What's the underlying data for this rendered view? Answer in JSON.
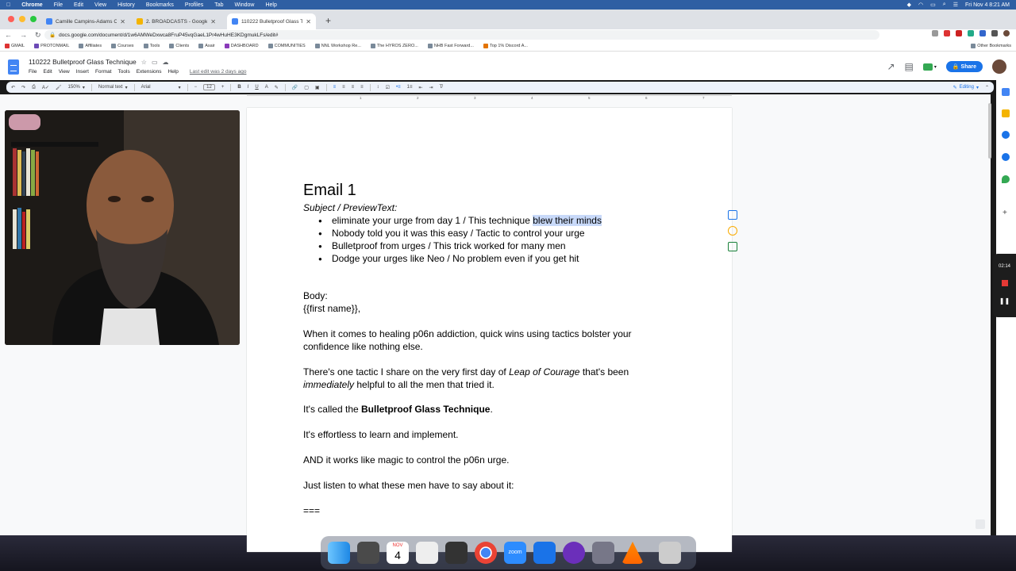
{
  "menubar": {
    "app": "Chrome",
    "items": [
      "File",
      "Edit",
      "View",
      "History",
      "Bookmarks",
      "Profiles",
      "Tab",
      "Window",
      "Help"
    ],
    "clock": "Fri Nov 4  8:21 AM"
  },
  "tabs": [
    {
      "title": "Camille Campins-Adams Copy",
      "color": "#4285f4"
    },
    {
      "title": "2. BROADCASTS - Google Dri",
      "color": "#f4b400"
    },
    {
      "title": "110222 Bulletproof Glass Techn",
      "color": "#4285f4"
    }
  ],
  "url": "docs.google.com/document/d/1w6AMWeDxwca8FruP45vqGaeL1Pr4wHuHE3KDgmukLFs/edit#",
  "bookmarks": [
    "GMAIL",
    "PROTONMAIL",
    "Affiliates",
    "Courses",
    "Tools",
    "Clients",
    "Asair",
    "DASHBOARD",
    "COMMUNITIES",
    "NNL Workshop Re...",
    "The HYROS ZERO...",
    "NHB Fast Forward...",
    "Top 1% Discord A..."
  ],
  "other_bookmarks": "Other Bookmarks",
  "doc": {
    "title": "110222 Bulletproof Glass Technique",
    "menu": [
      "File",
      "Edit",
      "View",
      "Insert",
      "Format",
      "Tools",
      "Extensions",
      "Help"
    ],
    "last_edit": "Last edit was 2 days ago",
    "share": "Share"
  },
  "format": {
    "zoom": "150%",
    "style": "Normal text",
    "font": "Arial",
    "size": "12",
    "mode": "Editing"
  },
  "ruler_ticks": [
    "1",
    "2",
    "3",
    "4",
    "5",
    "6",
    "7"
  ],
  "content": {
    "heading": "Email 1",
    "subject_label": "Subject / PreviewText:",
    "bullets": [
      {
        "a": "eliminate your urge from day 1 / This technique ",
        "hl": "blew their minds"
      },
      {
        "a": "Nobody told you it was this easy / Tactic to control your urge",
        "hl": ""
      },
      {
        "a": "Bulletproof from urges / This trick worked for many men",
        "hl": ""
      },
      {
        "a": "Dodge your urges like Neo / No problem even if you get hit",
        "hl": ""
      }
    ],
    "body_label": "Body:",
    "greeting": "{{first name}},",
    "p1": "When it comes to healing p06n addiction, quick wins using tactics bolster your confidence like nothing else.",
    "p2a": "There's one tactic I share on the very first day of ",
    "p2_italic": "Leap of Courage",
    "p2b": " that's been",
    "p2_italic2": "immediately",
    "p2c": " helpful to all the men that tried it.",
    "p3a": "It's called the ",
    "p3_bold": "Bulletproof Glass Technique",
    "p3b": ".",
    "p4": "It's effortless to learn and implement.",
    "p5": "AND it works like magic to control the p06n urge.",
    "p6": "Just listen to what these men have to say about it:",
    "p7": "==="
  },
  "recorder": {
    "time": "02:14"
  },
  "dock": {
    "calendar_month": "NOV",
    "calendar_day": "4",
    "zoom_label": "zoom"
  }
}
